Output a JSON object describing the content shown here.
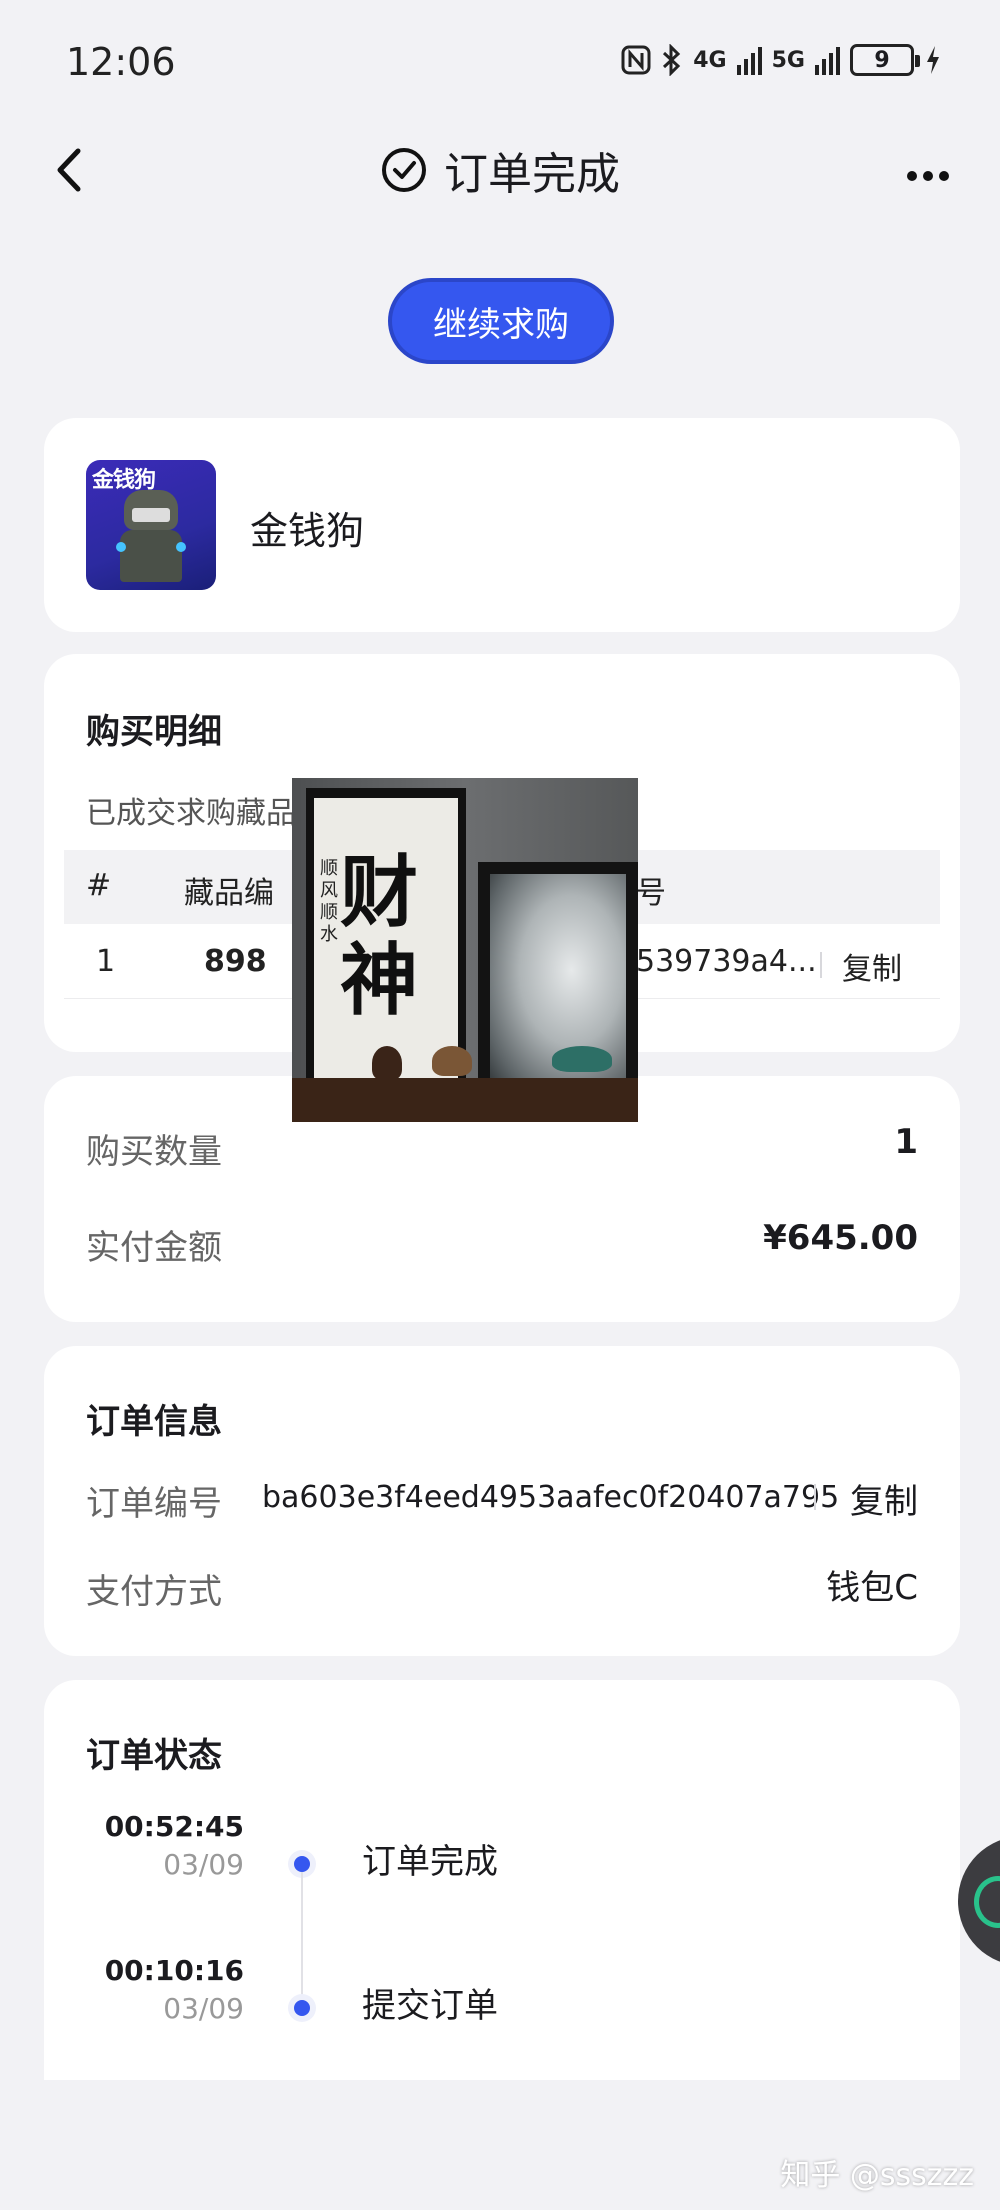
{
  "status_bar": {
    "time": "12:06",
    "network_4g": "4G",
    "network_5g": "5G",
    "battery": "9"
  },
  "header": {
    "title": "订单完成",
    "icons": [
      "back-chevron-icon",
      "check-circle-icon",
      "more-dots-icon"
    ]
  },
  "actions": {
    "continue_label": "继续求购"
  },
  "product": {
    "thumb_text": "金钱狗",
    "name": "金钱狗"
  },
  "purchase_detail": {
    "title": "购买明细",
    "subtitle": "已成交求购藏品",
    "columns": [
      "#",
      "藏品编",
      "号"
    ],
    "rows": [
      {
        "index": "1",
        "item_no": "898",
        "hash": "539739a4...",
        "copy_label": "复制"
      }
    ]
  },
  "summary": {
    "qty_label": "购买数量",
    "qty_value": "1",
    "amount_label": "实付金额",
    "amount_value": "¥645.00"
  },
  "order_info": {
    "title": "订单信息",
    "order_no_label": "订单编号",
    "order_no_value": "ba603e3f4eed4953aafec0f20407a795",
    "copy_label": "复制",
    "pay_method_label": "支付方式",
    "pay_method_value": "钱包C"
  },
  "order_status": {
    "title": "订单状态",
    "events": [
      {
        "time": "00:52:45",
        "date": "03/09",
        "label": "订单完成"
      },
      {
        "time": "00:10:16",
        "date": "03/09",
        "label": "提交订单"
      }
    ]
  },
  "overlay_image": {
    "characters": [
      "财",
      "神"
    ],
    "small_text": "顺风顺水"
  },
  "watermark": "知乎 @ssszzz",
  "colors": {
    "accent": "#3557ef",
    "background": "#f2f2f5",
    "card": "#ffffff"
  }
}
